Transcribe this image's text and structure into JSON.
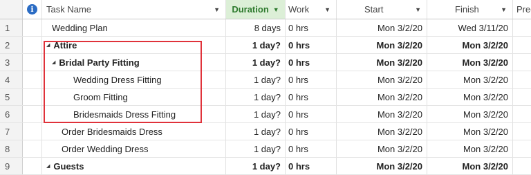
{
  "columns": {
    "info_symbol": "i",
    "task_name": "Task Name",
    "duration": "Duration",
    "work": "Work",
    "start": "Start",
    "finish": "Finish",
    "predecessors": "Predecessor"
  },
  "rows": [
    {
      "num": "1",
      "name": "Wedding Plan",
      "duration": "8 days",
      "work": "0 hrs",
      "start": "Mon 3/2/20",
      "finish": "Wed 3/11/20"
    },
    {
      "num": "2",
      "name": "Attire",
      "duration": "1 day?",
      "work": "0 hrs",
      "start": "Mon 3/2/20",
      "finish": "Mon 3/2/20"
    },
    {
      "num": "3",
      "name": "Bridal Party Fitting",
      "duration": "1 day?",
      "work": "0 hrs",
      "start": "Mon 3/2/20",
      "finish": "Mon 3/2/20"
    },
    {
      "num": "4",
      "name": "Wedding Dress Fitting",
      "duration": "1 day?",
      "work": "0 hrs",
      "start": "Mon 3/2/20",
      "finish": "Mon 3/2/20"
    },
    {
      "num": "5",
      "name": "Groom Fitting",
      "duration": "1 day?",
      "work": "0 hrs",
      "start": "Mon 3/2/20",
      "finish": "Mon 3/2/20"
    },
    {
      "num": "6",
      "name": "Bridesmaids Dress Fitting",
      "duration": "1 day?",
      "work": "0 hrs",
      "start": "Mon 3/2/20",
      "finish": "Mon 3/2/20"
    },
    {
      "num": "7",
      "name": "Order Bridesmaids Dress",
      "duration": "1 day?",
      "work": "0 hrs",
      "start": "Mon 3/2/20",
      "finish": "Mon 3/2/20"
    },
    {
      "num": "8",
      "name": "Order Wedding Dress",
      "duration": "1 day?",
      "work": "0 hrs",
      "start": "Mon 3/2/20",
      "finish": "Mon 3/2/20"
    },
    {
      "num": "9",
      "name": "Guests",
      "duration": "1 day?",
      "work": "0 hrs",
      "start": "Mon 3/2/20",
      "finish": "Mon 3/2/20"
    }
  ],
  "colors": {
    "highlight_border": "#e0323a",
    "duration_header_bg": "#dcefd7",
    "duration_header_text": "#2e7a2e",
    "info_icon": "#2b6cc4"
  }
}
